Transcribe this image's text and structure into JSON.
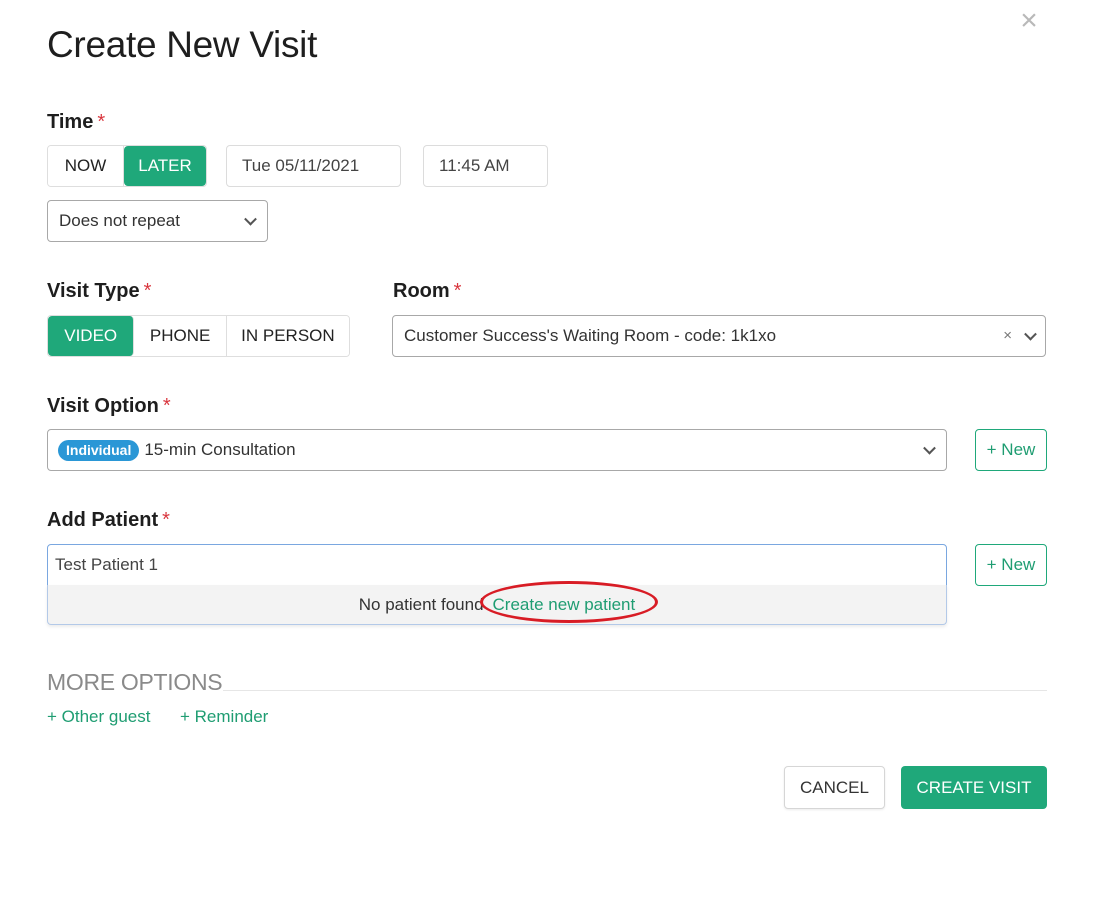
{
  "dialog": {
    "title": "Create New Visit",
    "close_icon": "close-icon"
  },
  "time": {
    "label": "Time",
    "required_mark": "*",
    "modes": [
      "NOW",
      "LATER"
    ],
    "active_mode": "LATER",
    "date": "Tue 05/11/2021",
    "time": "11:45 AM",
    "repeat": "Does not repeat"
  },
  "visit_type": {
    "label": "Visit Type",
    "required_mark": "*",
    "options": [
      "VIDEO",
      "PHONE",
      "IN PERSON"
    ],
    "active": "VIDEO"
  },
  "room": {
    "label": "Room",
    "required_mark": "*",
    "value": "Customer Success's Waiting Room - code: 1k1xo",
    "clear_glyph": "×"
  },
  "visit_option": {
    "label": "Visit Option",
    "required_mark": "*",
    "badge": "Individual",
    "value": "15-min Consultation",
    "new_label": "+ New"
  },
  "add_patient": {
    "label": "Add Patient",
    "required_mark": "*",
    "value": "Test Patient 1",
    "new_label": "+ New",
    "dropdown_message": "No patient found",
    "dropdown_link": "Create new patient"
  },
  "more_options": {
    "title": "MORE OPTIONS",
    "links": [
      "+ Other guest",
      "+ Reminder"
    ]
  },
  "actions": {
    "cancel": "CANCEL",
    "create": "CREATE VISIT"
  },
  "colors": {
    "accent": "#1fa87a",
    "badge": "#2a97d6",
    "required": "#d9363e",
    "annotation": "#d81c25"
  }
}
